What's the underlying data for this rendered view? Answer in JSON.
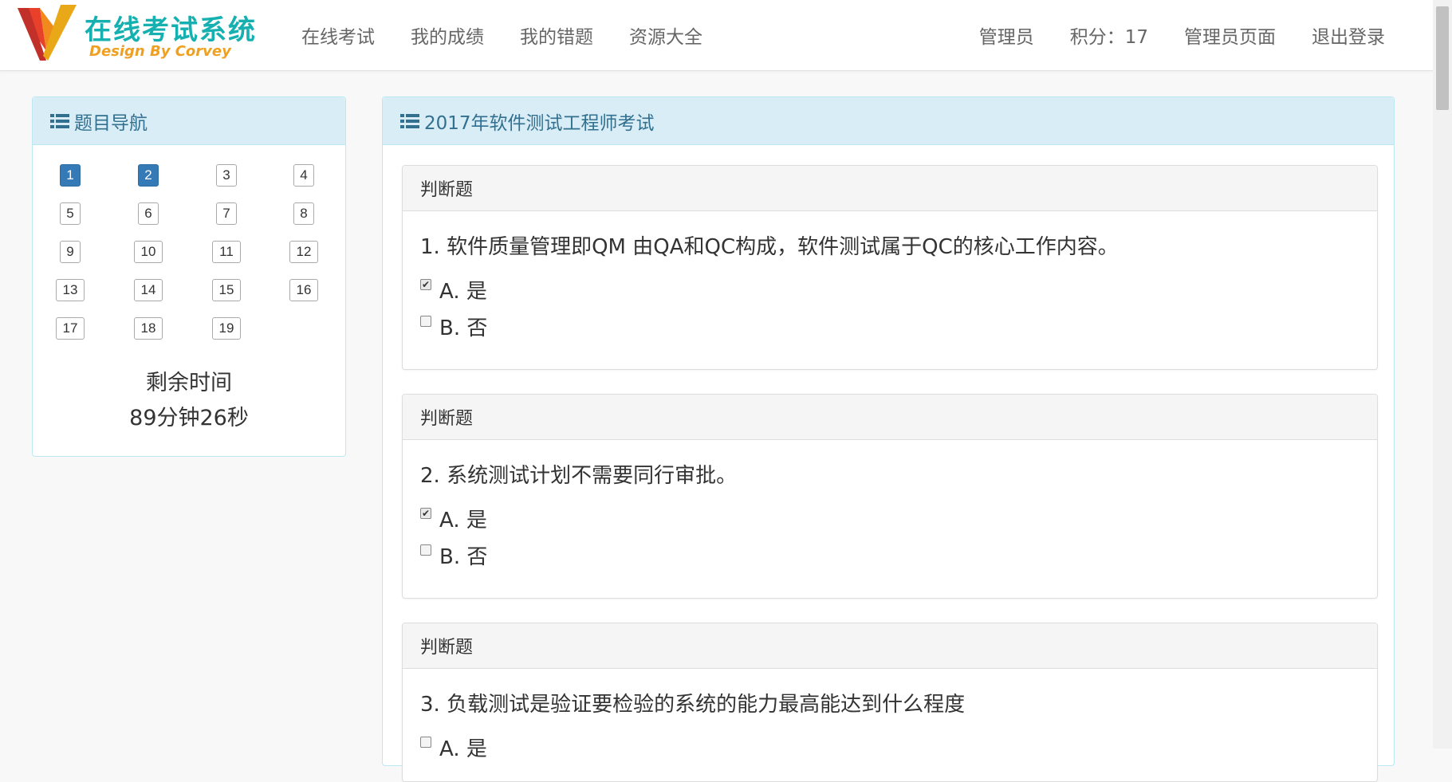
{
  "brand": {
    "title": "在线考试系统",
    "subtitle": "Design By Corvey"
  },
  "nav": {
    "left": [
      "在线考试",
      "我的成绩",
      "我的错题",
      "资源大全"
    ],
    "right": [
      "管理员",
      "积分：17",
      "管理员页面",
      "退出登录"
    ]
  },
  "question_nav": {
    "title": "题目导航",
    "buttons": [
      {
        "label": "1",
        "answered": true
      },
      {
        "label": "2",
        "answered": true
      },
      {
        "label": "3",
        "answered": false
      },
      {
        "label": "4",
        "answered": false
      },
      {
        "label": "5",
        "answered": false
      },
      {
        "label": "6",
        "answered": false
      },
      {
        "label": "7",
        "answered": false
      },
      {
        "label": "8",
        "answered": false
      },
      {
        "label": "9",
        "answered": false
      },
      {
        "label": "10",
        "answered": false
      },
      {
        "label": "11",
        "answered": false
      },
      {
        "label": "12",
        "answered": false
      },
      {
        "label": "13",
        "answered": false
      },
      {
        "label": "14",
        "answered": false
      },
      {
        "label": "15",
        "answered": false
      },
      {
        "label": "16",
        "answered": false
      },
      {
        "label": "17",
        "answered": false
      },
      {
        "label": "18",
        "answered": false
      },
      {
        "label": "19",
        "answered": false
      }
    ],
    "timer_label": "剩余时间",
    "timer_value": "89分钟26秒"
  },
  "exam": {
    "title": "2017年软件测试工程师考试",
    "questions": [
      {
        "type": "判断题",
        "text": "1. 软件质量管理即QM 由QA和QC构成，软件测试属于QC的核心工作内容。",
        "options": [
          {
            "label": "A. 是",
            "checked": true
          },
          {
            "label": "B. 否",
            "checked": false
          }
        ]
      },
      {
        "type": "判断题",
        "text": "2. 系统测试计划不需要同行审批。",
        "options": [
          {
            "label": "A. 是",
            "checked": true
          },
          {
            "label": "B. 否",
            "checked": false
          }
        ]
      },
      {
        "type": "判断题",
        "text": "3. 负载测试是验证要检验的系统的能力最高能达到什么程度",
        "options": [
          {
            "label": "A. 是",
            "checked": false
          }
        ]
      }
    ]
  },
  "colors": {
    "brand_teal": "#17b0b0",
    "brand_orange": "#f0a020",
    "active_button": "#337ab7",
    "panel_heading_bg": "#d9edf7",
    "panel_heading_text": "#31708f"
  },
  "icons": {
    "panel_heading": "list-icon",
    "checkbox_checked": "checkmark-icon"
  }
}
